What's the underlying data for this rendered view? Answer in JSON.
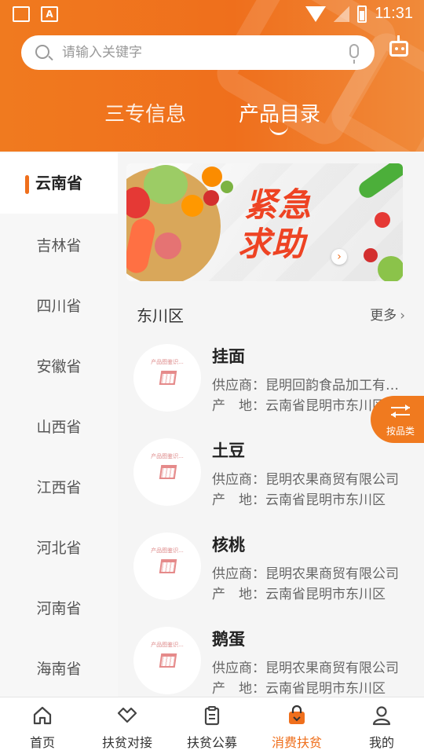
{
  "status_bar": {
    "time": "11:31"
  },
  "search": {
    "placeholder": "请输入关键字"
  },
  "tabs": [
    {
      "label": "三专信息",
      "active": false
    },
    {
      "label": "产品目录",
      "active": true
    }
  ],
  "sidebar": {
    "items": [
      {
        "label": "云南省",
        "active": true
      },
      {
        "label": "吉林省"
      },
      {
        "label": "四川省"
      },
      {
        "label": "安徽省"
      },
      {
        "label": "山西省"
      },
      {
        "label": "江西省"
      },
      {
        "label": "河北省"
      },
      {
        "label": "河南省"
      },
      {
        "label": "海南省"
      }
    ]
  },
  "banner": {
    "line1": "紧急",
    "line2": "求助"
  },
  "section": {
    "title": "东川区",
    "more_label": "更多"
  },
  "products": [
    {
      "name": "挂面",
      "supplier": "供应商：昆明回韵食品加工有限公司",
      "origin": "产　地：云南省昆明市东川区",
      "thumb_text": "产品图鉴识..."
    },
    {
      "name": "土豆",
      "supplier": "供应商：昆明农果商贸有限公司",
      "origin": "产　地：云南省昆明市东川区",
      "thumb_text": "产品图鉴识..."
    },
    {
      "name": "核桃",
      "supplier": "供应商：昆明农果商贸有限公司",
      "origin": "产　地：云南省昆明市东川区",
      "thumb_text": "产品图鉴识..."
    },
    {
      "name": "鹅蛋",
      "supplier": "供应商：昆明农果商贸有限公司",
      "origin": "产　地：云南省昆明市东川区",
      "thumb_text": "产品图鉴识..."
    }
  ],
  "float_button": {
    "label": "按品类"
  },
  "bottom_nav": [
    {
      "label": "首页",
      "icon": "home-icon"
    },
    {
      "label": "扶贫对接",
      "icon": "handshake-icon"
    },
    {
      "label": "扶贫公募",
      "icon": "clipboard-icon"
    },
    {
      "label": "消费扶贫",
      "icon": "shopping-bag-icon",
      "active": true
    },
    {
      "label": "我的",
      "icon": "user-icon"
    }
  ],
  "colors": {
    "accent": "#ef6f1c",
    "banner_text": "#ee4323"
  }
}
